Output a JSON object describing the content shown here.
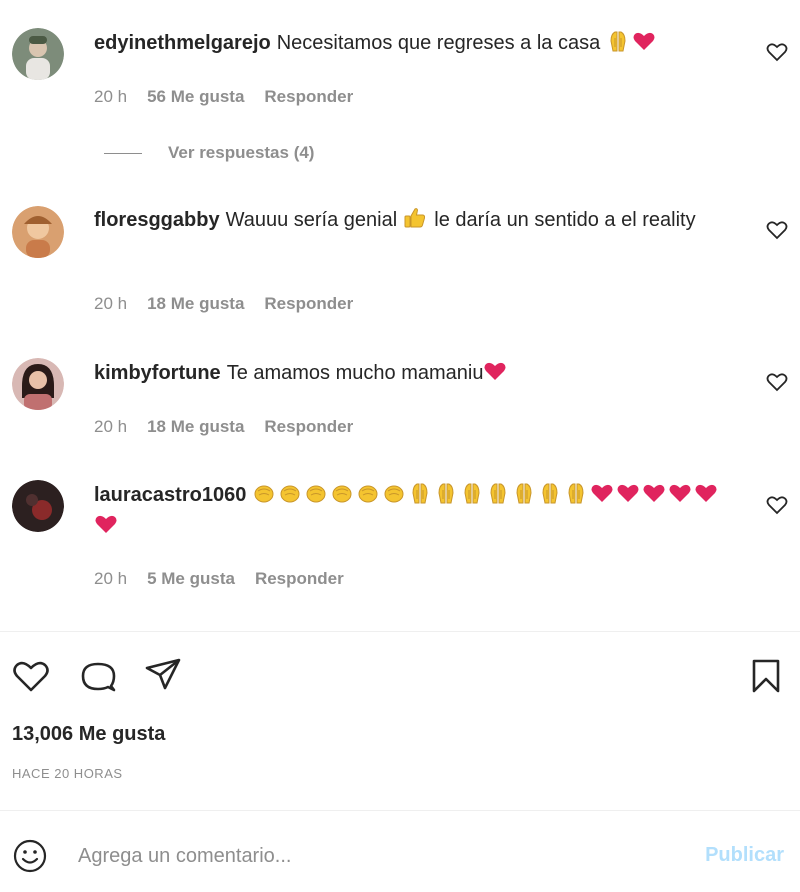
{
  "comments": [
    {
      "username": "edyinethmelgarejo",
      "text": "Necesitamos que regreses a la casa",
      "emojis_after": [
        "praying-hands-emoji",
        "red-heart-emoji"
      ],
      "time": "20 h",
      "likes": "56 Me gusta",
      "reply_label": "Responder",
      "avatar_color": "#6a7b6d"
    },
    {
      "username": "floresggabby",
      "text_before": "Wauuu sería genial",
      "text_after": "le daría un sentido a el reality",
      "emoji_middle": "thumbs-up-emoji",
      "time": "20 h",
      "likes": "18 Me gusta",
      "reply_label": "Responder",
      "avatar_color": "#c98a5a"
    },
    {
      "username": "kimbyfortune",
      "text": "Te amamos mucho mamaniu",
      "emojis_after": [
        "red-heart-emoji"
      ],
      "time": "20 h",
      "likes": "18 Me gusta",
      "reply_label": "Responder",
      "avatar_color": "#b07a78"
    },
    {
      "username": "lauracastro1060",
      "emojis": [
        "clapping-emoji",
        "clapping-emoji",
        "clapping-emoji",
        "clapping-emoji",
        "clapping-emoji",
        "clapping-emoji",
        "praying-hands-emoji",
        "praying-hands-emoji",
        "praying-hands-emoji",
        "praying-hands-emoji",
        "praying-hands-emoji",
        "praying-hands-emoji",
        "praying-hands-emoji",
        "red-heart-emoji",
        "red-heart-emoji",
        "red-heart-emoji",
        "red-heart-emoji",
        "red-heart-emoji",
        "red-heart-emoji"
      ],
      "time": "20 h",
      "likes": "5 Me gusta",
      "reply_label": "Responder",
      "avatar_color": "#3a2020"
    }
  ],
  "view_replies": "Ver respuestas (4)",
  "post": {
    "likes": "13,006 Me gusta",
    "time_ago": "HACE 20 HORAS"
  },
  "add_comment": {
    "placeholder": "Agrega un comentario...",
    "publish_label": "Publicar"
  },
  "colors": {
    "text": "#262626",
    "muted": "#8e8e8e",
    "publish_disabled": "#b2dffc",
    "heart_red": "#e0245e"
  }
}
